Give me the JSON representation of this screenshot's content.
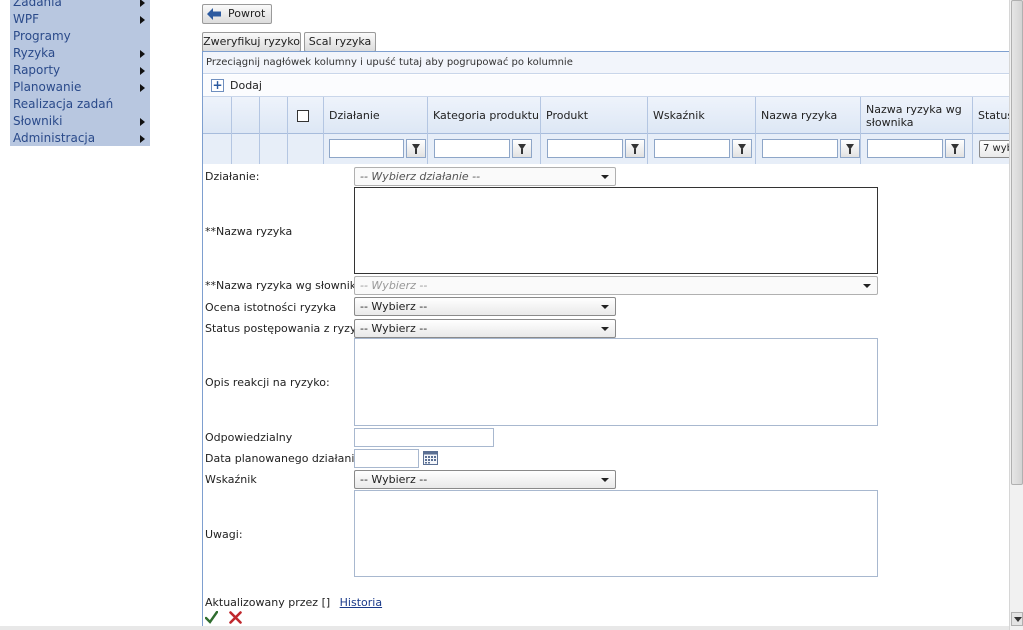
{
  "sidebar": {
    "items": [
      {
        "label": "Zadania",
        "submenu": true
      },
      {
        "label": "WPF",
        "submenu": true
      },
      {
        "label": "Programy",
        "submenu": false
      },
      {
        "label": "Ryzyka",
        "submenu": true
      },
      {
        "label": "Raporty",
        "submenu": true
      },
      {
        "label": "Planowanie",
        "submenu": true
      },
      {
        "label": "Realizacja zadań",
        "submenu": false
      },
      {
        "label": "Słowniki",
        "submenu": true
      },
      {
        "label": "Administracja",
        "submenu": true
      }
    ]
  },
  "toolbar": {
    "back_label": "Powrot",
    "verify_label": "Zweryfikuj ryzyko",
    "merge_label": "Scal ryzyka"
  },
  "grid": {
    "group_hint": "Przeciągnij nagłówek kolumny i upuść tutaj aby pogrupować po kolumnie",
    "add_label": "Dodaj",
    "columns": [
      "Działanie",
      "Kategoria produktu",
      "Produkt",
      "Wskaźnik",
      "Nazwa ryzyka",
      "Nazwa ryzyka wg słownika",
      "Status"
    ],
    "status_filter": "7 wyb"
  },
  "form": {
    "dzialanie_label": "Działanie:",
    "dzialanie_placeholder": "-- Wybierz działanie --",
    "nazwa_label": "**Nazwa ryzyka",
    "nazwa_slownik_label": "**Nazwa ryzyka wg słownika",
    "nazwa_slownik_placeholder": "-- Wybierz --",
    "ocena_label": "Ocena istotności ryzyka",
    "ocena_value": "-- Wybierz --",
    "status_label": "Status postępowania z ryzykiem",
    "status_value": "-- Wybierz --",
    "opis_label": "Opis reakcji na ryzyko:",
    "odpowiedzialny_label": "Odpowiedzialny",
    "data_label": "Data planowanego działania",
    "wskaznik_label": "Wskaźnik",
    "wskaznik_value": "-- Wybierz --",
    "uwagi_label": "Uwagi:",
    "updated_by": "Aktualizowany przez []",
    "history_link": "Historia"
  },
  "colors": {
    "sidebar_bg": "#b8c7e0",
    "link": "#1a3a8a",
    "save_check": "#2f6d2f",
    "cancel_x": "#c0282d"
  }
}
